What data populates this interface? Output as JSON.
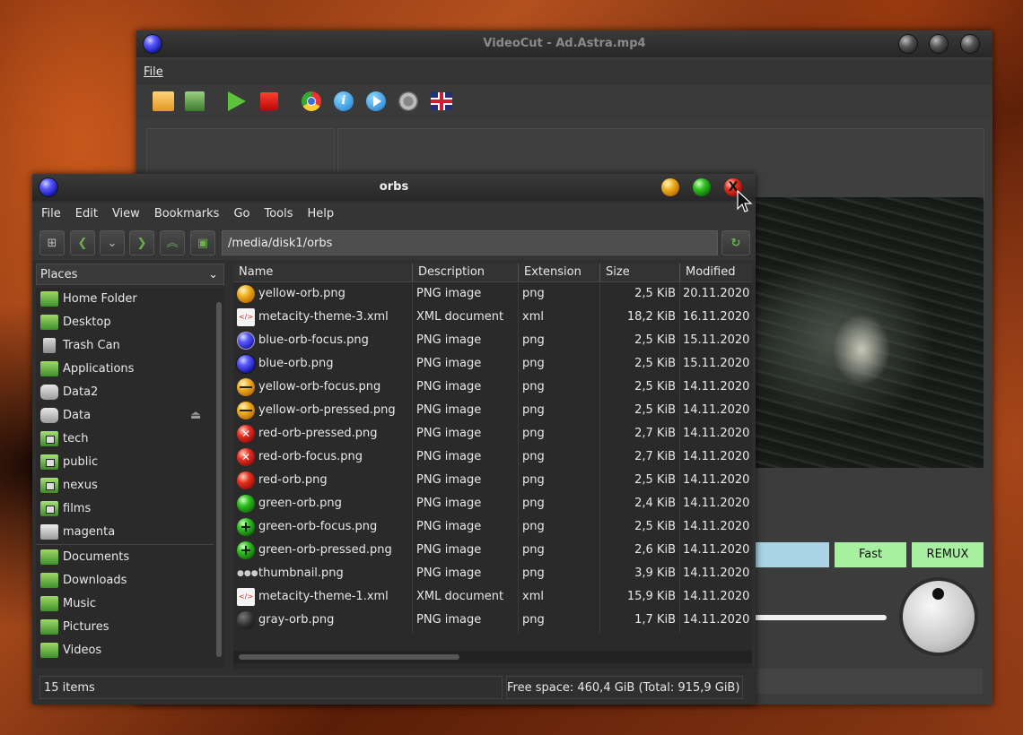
{
  "videocut": {
    "title": "VideoCut - Ad.Astra.mp4",
    "menu_file": "File",
    "toolbar": [
      "open-folder-icon",
      "save-icon",
      "play-icon",
      "stop-icon",
      "chrome-icon",
      "info-icon",
      "forward-icon",
      "settings-icon",
      "language-flag-icon"
    ],
    "fast_label": "Fast",
    "remux_label": "REMUX"
  },
  "fm": {
    "title": "orbs",
    "menu": [
      "File",
      "Edit",
      "View",
      "Bookmarks",
      "Go",
      "Tools",
      "Help"
    ],
    "path": "/media/disk1/orbs",
    "places_label": "Places",
    "places": [
      {
        "label": "Home Folder",
        "icon": "home-icon"
      },
      {
        "label": "Desktop",
        "icon": "desktop-icon"
      },
      {
        "label": "Trash Can",
        "icon": "trash-icon"
      },
      {
        "label": "Applications",
        "icon": "applications-icon"
      },
      {
        "label": "Data2",
        "icon": "disk-icon"
      },
      {
        "label": "Data",
        "icon": "disk-icon"
      },
      {
        "label": "tech",
        "icon": "network-folder-icon"
      },
      {
        "label": "public",
        "icon": "network-folder-icon"
      },
      {
        "label": "nexus",
        "icon": "network-folder-icon"
      },
      {
        "label": "films",
        "icon": "network-folder-icon"
      },
      {
        "label": "magenta",
        "icon": "network-drive-icon"
      },
      {
        "label": "Documents",
        "icon": "folder-icon"
      },
      {
        "label": "Downloads",
        "icon": "folder-icon"
      },
      {
        "label": "Music",
        "icon": "folder-icon"
      },
      {
        "label": "Pictures",
        "icon": "folder-icon"
      },
      {
        "label": "Videos",
        "icon": "folder-icon"
      }
    ],
    "columns": [
      "Name",
      "Description",
      "Extension",
      "Size",
      "Modified"
    ],
    "files": [
      {
        "name": "yellow-orb.png",
        "desc": "PNG image",
        "ext": "png",
        "size": "2,5 KiB",
        "mod": "20.11.2020",
        "icon": "yellow-orb-icon"
      },
      {
        "name": "metacity-theme-3.xml",
        "desc": "XML document",
        "ext": "xml",
        "size": "18,2 KiB",
        "mod": "16.11.2020",
        "icon": "xml-file-icon"
      },
      {
        "name": "blue-orb-focus.png",
        "desc": "PNG image",
        "ext": "png",
        "size": "2,5 KiB",
        "mod": "15.11.2020",
        "icon": "blue-orb-focus-icon"
      },
      {
        "name": "blue-orb.png",
        "desc": "PNG image",
        "ext": "png",
        "size": "2,5 KiB",
        "mod": "15.11.2020",
        "icon": "blue-orb-icon"
      },
      {
        "name": "yellow-orb-focus.png",
        "desc": "PNG image",
        "ext": "png",
        "size": "2,5 KiB",
        "mod": "14.11.2020",
        "icon": "yellow-orb-focus-icon"
      },
      {
        "name": "yellow-orb-pressed.png",
        "desc": "PNG image",
        "ext": "png",
        "size": "2,5 KiB",
        "mod": "14.11.2020",
        "icon": "yellow-orb-pressed-icon"
      },
      {
        "name": "red-orb-pressed.png",
        "desc": "PNG image",
        "ext": "png",
        "size": "2,7 KiB",
        "mod": "14.11.2020",
        "icon": "red-orb-pressed-icon"
      },
      {
        "name": "red-orb-focus.png",
        "desc": "PNG image",
        "ext": "png",
        "size": "2,7 KiB",
        "mod": "14.11.2020",
        "icon": "red-orb-focus-icon"
      },
      {
        "name": "red-orb.png",
        "desc": "PNG image",
        "ext": "png",
        "size": "2,5 KiB",
        "mod": "14.11.2020",
        "icon": "red-orb-icon"
      },
      {
        "name": "green-orb.png",
        "desc": "PNG image",
        "ext": "png",
        "size": "2,4 KiB",
        "mod": "14.11.2020",
        "icon": "green-orb-icon"
      },
      {
        "name": "green-orb-focus.png",
        "desc": "PNG image",
        "ext": "png",
        "size": "2,5 KiB",
        "mod": "14.11.2020",
        "icon": "green-orb-focus-icon"
      },
      {
        "name": "green-orb-pressed.png",
        "desc": "PNG image",
        "ext": "png",
        "size": "2,6 KiB",
        "mod": "14.11.2020",
        "icon": "green-orb-pressed-icon"
      },
      {
        "name": "thumbnail.png",
        "desc": "PNG image",
        "ext": "png",
        "size": "3,9 KiB",
        "mod": "14.11.2020",
        "icon": "thumbnail-icon"
      },
      {
        "name": "metacity-theme-1.xml",
        "desc": "XML document",
        "ext": "xml",
        "size": "15,9 KiB",
        "mod": "14.11.2020",
        "icon": "xml-file-icon"
      },
      {
        "name": "gray-orb.png",
        "desc": "PNG image",
        "ext": "png",
        "size": "1,7 KiB",
        "mod": "14.11.2020",
        "icon": "gray-orb-icon"
      }
    ],
    "status_count": "15 items",
    "status_free": "Free space: 460,4 GiB (Total: 915,9 GiB)"
  }
}
